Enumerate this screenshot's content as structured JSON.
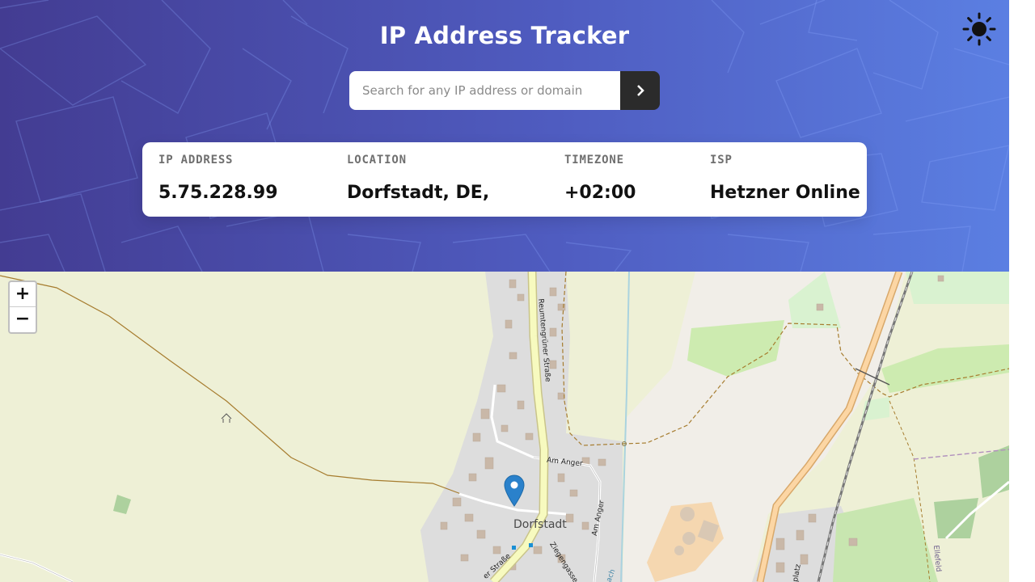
{
  "header": {
    "title": "IP Address Tracker",
    "theme_icon": "sun-icon"
  },
  "search": {
    "placeholder": "Search for any IP address or domain",
    "value": "",
    "button_icon": "chevron-right-icon"
  },
  "info": {
    "ip": {
      "label": "IP ADDRESS",
      "value": "5.75.228.99"
    },
    "location": {
      "label": "LOCATION",
      "value": "Dorfstadt, DE,"
    },
    "timezone": {
      "label": "TIMEZONE",
      "value": "+02:00"
    },
    "isp": {
      "label": "ISP",
      "value": "Hetzner Online"
    }
  },
  "map": {
    "zoom_in": "+",
    "zoom_out": "−",
    "labels": {
      "town": "Dorfstadt",
      "street_main": "Reumtengrüner Straße",
      "street_anger_1": "Am Anger",
      "street_anger_2": "Am Anger",
      "street_ziegen": "Ziegengasse",
      "street_south": "er Straße",
      "street_ellefeld": "Ellefeld",
      "street_platz": "platz",
      "stream": "bach"
    },
    "marker_icon": "location-pin-icon"
  },
  "colors": {
    "header_gradient_start": "#433c92",
    "header_gradient_end": "#5b7fe2",
    "search_button": "#2b2b2b",
    "marker": "#2a81cb",
    "map_background": "#eef0d6"
  }
}
